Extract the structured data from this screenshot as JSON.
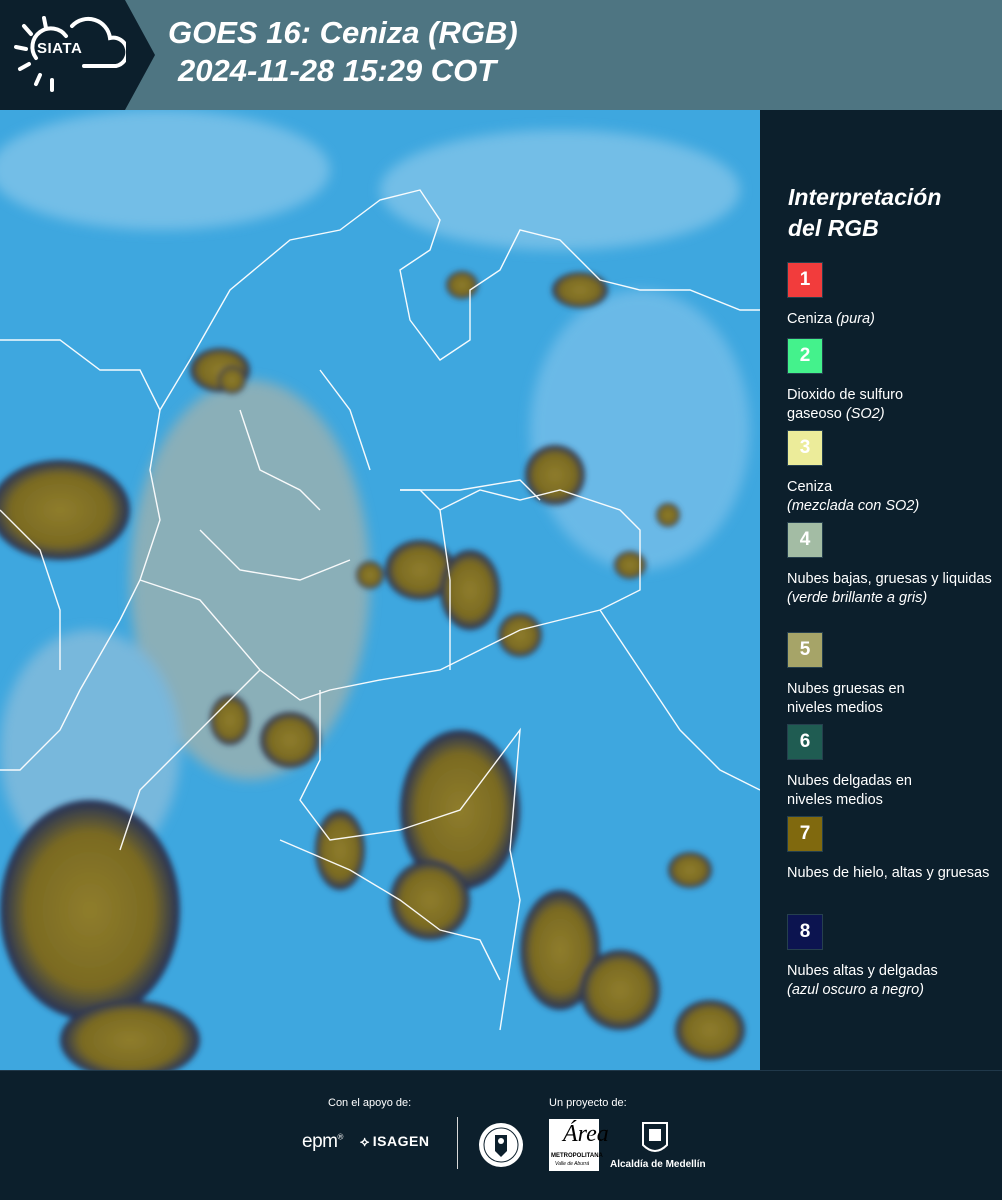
{
  "header": {
    "logo_text": "SIATA",
    "title_line1": "GOES 16: Ceniza (RGB)",
    "title_line2": "2024-11-28 15:29 COT",
    "bg_color": "#4e7582"
  },
  "map": {
    "background_color": "#3ea7df",
    "cloud_color": "#8a7a2a",
    "border_color": "#ffffff"
  },
  "legend": {
    "title_line1": "Interpretación",
    "title_line2": "del RGB",
    "items": [
      {
        "number": "1",
        "color": "#f23c3c",
        "text": "Ceniza",
        "note": "(pura)"
      },
      {
        "number": "2",
        "color": "#44f28c",
        "text": "Dioxido de sulfuro gaseoso",
        "note": "(SO2)"
      },
      {
        "number": "3",
        "color": "#ecec9a",
        "text": "Ceniza",
        "note": "(mezclada con SO2)"
      },
      {
        "number": "4",
        "color": "#a3bca4",
        "text": "Nubes bajas, gruesas y liquidas",
        "note": "(verde brillante a gris)"
      },
      {
        "number": "5",
        "color": "#a6a468",
        "text": "Nubes gruesas en niveles medios",
        "note": ""
      },
      {
        "number": "6",
        "color": "#1f5c52",
        "text": "Nubes delgadas en niveles medios",
        "note": ""
      },
      {
        "number": "7",
        "color": "#80690e",
        "text": "Nubes de hielo, altas y gruesas",
        "note": ""
      },
      {
        "number": "8",
        "color": "#0c1450",
        "text": "Nubes altas y delgadas",
        "note": "(azul oscuro a negro)"
      }
    ]
  },
  "footer": {
    "support_label": "Con el apoyo de:",
    "project_label": "Un proyecto de:",
    "epm": "epm",
    "isagen": "ISAGEN",
    "area_mark": "Área",
    "area_sub": "METROPOLITANA",
    "area_sub2": "Valle de Aburrá",
    "alcaldia": "Alcaldía de Medellín"
  }
}
